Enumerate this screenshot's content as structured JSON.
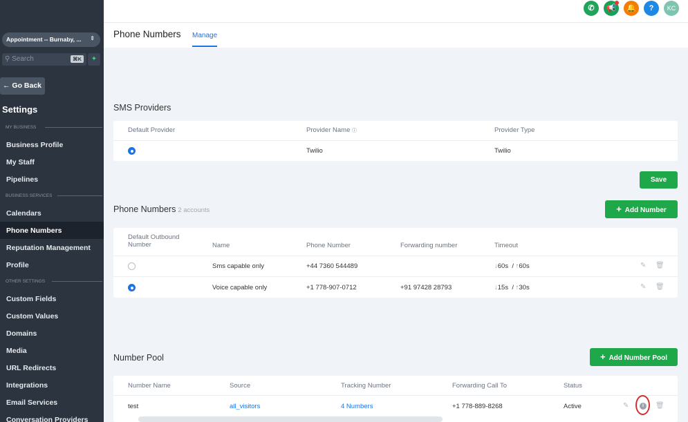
{
  "sidebar": {
    "location": "Appointment -- Burnaby, ...",
    "search_placeholder": "Search",
    "search_shortcut": "⌘K",
    "go_back": "← Go Back",
    "title": "Settings",
    "sections": {
      "my_business": "MY BUSINESS",
      "business_services": "BUSINESS SERVICES",
      "other_settings": "OTHER SETTINGS"
    },
    "items": [
      {
        "label": "Business Profile"
      },
      {
        "label": "My Staff"
      },
      {
        "label": "Pipelines"
      },
      {
        "label": "Calendars"
      },
      {
        "label": "Phone Numbers",
        "active": true
      },
      {
        "label": "Reputation Management"
      },
      {
        "label": "Profile"
      },
      {
        "label": "Custom Fields"
      },
      {
        "label": "Custom Values"
      },
      {
        "label": "Domains"
      },
      {
        "label": "Media"
      },
      {
        "label": "URL Redirects"
      },
      {
        "label": "Integrations"
      },
      {
        "label": "Email Services"
      },
      {
        "label": "Conversation Providers"
      }
    ]
  },
  "topbar": {
    "avatar_initials": "KC",
    "help_label": "?",
    "colors": {
      "phone": "#20a35a",
      "announce": "#17a05a",
      "bell": "#f57c00",
      "help": "#1e88e5",
      "avatar": "#7fc4b0"
    }
  },
  "header": {
    "title": "Phone Numbers",
    "tab": "Manage"
  },
  "sms_providers": {
    "title": "SMS Providers",
    "columns": [
      "Default Provider",
      "Provider Name",
      "Provider Type"
    ],
    "rows": [
      {
        "default": true,
        "name": "Twilio",
        "type": "Twilio"
      }
    ],
    "save_label": "Save"
  },
  "phone_numbers": {
    "title": "Phone Numbers",
    "count_label": "2 accounts",
    "add_label": "Add Number",
    "columns": [
      "Default Outbound Number",
      "Name",
      "Phone Number",
      "Forwarding number",
      "Timeout"
    ],
    "rows": [
      {
        "default": false,
        "name": "Sms capable only",
        "phone": "+44 7360 544489",
        "forwarding": "",
        "timeout_down": "60s",
        "timeout_up": "60s"
      },
      {
        "default": true,
        "name": "Voice capable only",
        "phone": "+1 778-907-0712",
        "forwarding": "+91 97428 28793",
        "timeout_down": "15s",
        "timeout_up": "30s"
      }
    ]
  },
  "number_pool": {
    "title": "Number Pool",
    "add_label": "Add Number Pool",
    "columns": [
      "Number Name",
      "Source",
      "Tracking Number",
      "Forwarding Call To",
      "Status"
    ],
    "rows": [
      {
        "name": "test",
        "source": "all_visitors",
        "tracking": "4 Numbers",
        "forwarding": "+1 778-889-8268",
        "status": "Active"
      }
    ]
  }
}
